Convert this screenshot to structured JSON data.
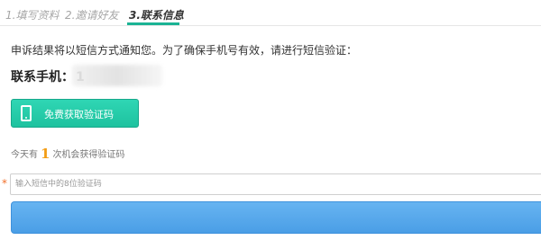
{
  "steps": [
    {
      "label": "1.填写资料"
    },
    {
      "label": "2.邀请好友"
    },
    {
      "label": "3.联系信息"
    }
  ],
  "notice": "申诉结果将以短信方式通知您。为了确保手机号有效，请进行短信验证：",
  "phone": {
    "label": "联系手机：",
    "value": "1"
  },
  "sms_button": {
    "label": "免费获取验证码",
    "icon": "mobile-phone-icon"
  },
  "chances": {
    "prefix": "今天有",
    "count": "1",
    "suffix": "次机会获得验证码"
  },
  "code_input": {
    "required_mark": "*",
    "placeholder": "输入短信中的8位验证码",
    "value": ""
  },
  "submit_button": {
    "label": ""
  },
  "colors": {
    "accent_green": "#1ab394",
    "count_orange": "#f39c12",
    "submit_blue": "#4a9ee6"
  }
}
